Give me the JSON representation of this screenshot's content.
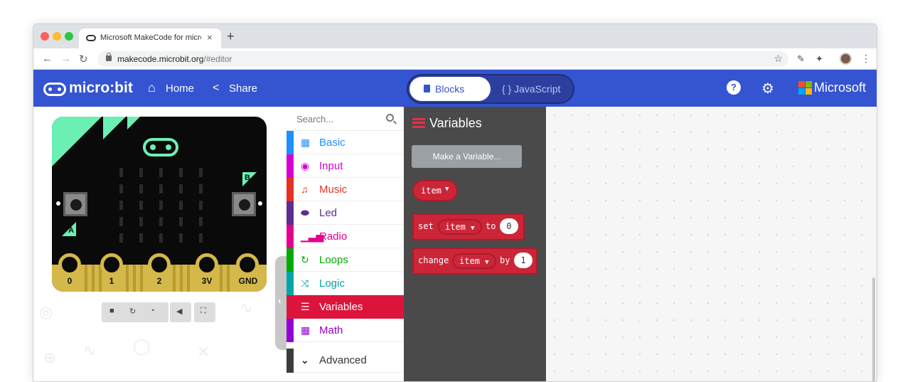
{
  "browser": {
    "tab_title": "Microsoft MakeCode for micro:bit",
    "tab_close": "×",
    "new_tab": "+",
    "url_host": "makecode.microbit.org",
    "url_path": "/#editor",
    "back": "←",
    "forward": "→",
    "reload": "↻",
    "bookmark": "☆",
    "menu": "⋮",
    "traffic_colors": [
      "#ff5f57",
      "#febc2e",
      "#28c840"
    ]
  },
  "header": {
    "logo": "micro:bit",
    "home_label": "Home",
    "share_label": "Share",
    "blocks_label": "Blocks",
    "javascript_label": "{ } JavaScript",
    "help_glyph": "?",
    "settings_glyph": "⚙",
    "microsoft_label": "Microsoft",
    "bg_color": "#3454d1"
  },
  "simulator": {
    "button_a": "A",
    "button_b": "B",
    "pins": [
      "0",
      "1",
      "2",
      "3V",
      "GND"
    ],
    "accent_color": "#6bf0b4",
    "controls": [
      "stop-icon",
      "restart-icon",
      "slow-motion-icon",
      "mute-icon",
      "fullscreen-icon"
    ]
  },
  "toolbox": {
    "search_placeholder": "Search...",
    "categories": [
      {
        "label": "Basic",
        "color": "#1e90ff",
        "icon": "grid-icon"
      },
      {
        "label": "Input",
        "color": "#d400d4",
        "icon": "target-icon"
      },
      {
        "label": "Music",
        "color": "#e63022",
        "icon": "headphones-icon"
      },
      {
        "label": "Led",
        "color": "#5c2d91",
        "icon": "toggle-icon"
      },
      {
        "label": "Radio",
        "color": "#e3008c",
        "icon": "signal-icon"
      },
      {
        "label": "Loops",
        "color": "#00aa00",
        "icon": "refresh-icon"
      },
      {
        "label": "Logic",
        "color": "#00a4a6",
        "icon": "shuffle-icon"
      },
      {
        "label": "Variables",
        "color": "#dc143c",
        "icon": "lines-icon"
      },
      {
        "label": "Math",
        "color": "#9400d3",
        "icon": "calculator-icon"
      },
      {
        "label": "Advanced",
        "color": "#3c3c3c",
        "icon": "chevron-down-icon"
      }
    ]
  },
  "flyout": {
    "title": "Variables",
    "make_variable": "Make a Variable...",
    "item_block": "item",
    "set_block": {
      "word1": "set",
      "var": "item",
      "word2": "to",
      "value": "0"
    },
    "change_block": {
      "word1": "change",
      "var": "item",
      "word2": "by",
      "value": "1"
    },
    "block_color": "#cc2538"
  }
}
